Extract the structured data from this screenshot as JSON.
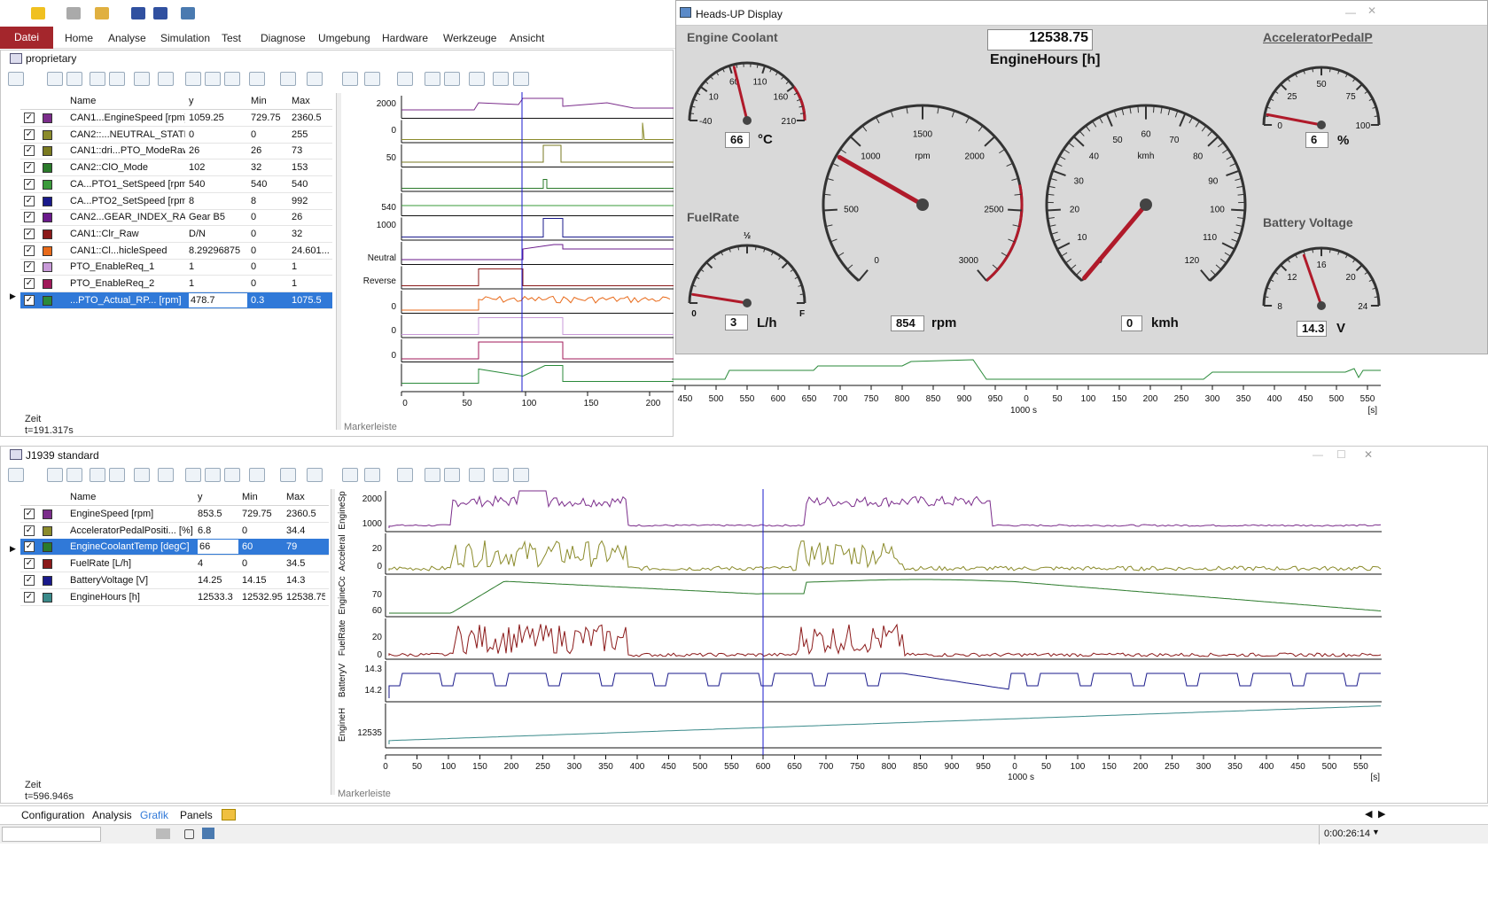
{
  "menu": {
    "file": "Datei",
    "items": [
      "Home",
      "Analyse",
      "Simulation",
      "Test",
      "Diagnose",
      "Umgebung",
      "Hardware",
      "Werkzeuge",
      "Ansicht"
    ]
  },
  "window1": {
    "title": "proprietary",
    "columns": [
      "Name",
      "y",
      "Min",
      "Max"
    ],
    "rows": [
      {
        "name": "CAN1...EngineSpeed [rpm]",
        "y": "1059.25",
        "min": "729.75",
        "max": "2360.5",
        "color": "#7b2d8b",
        "selected": false
      },
      {
        "name": "CAN2::...NEUTRAL_STATE",
        "y": "0",
        "min": "0",
        "max": "255",
        "color": "#8b8b2b",
        "selected": false
      },
      {
        "name": "CAN1::dri...PTO_ModeRaw",
        "y": "26",
        "min": "26",
        "max": "73",
        "color": "#7a7a20",
        "selected": false
      },
      {
        "name": "CAN2::ClO_Mode",
        "y": "102",
        "min": "32",
        "max": "153",
        "color": "#2a7a2a",
        "selected": false
      },
      {
        "name": "CA...PTO1_SetSpeed [rpm]",
        "y": "540",
        "min": "540",
        "max": "540",
        "color": "#3a9a3a",
        "selected": false
      },
      {
        "name": "CA...PTO2_SetSpeed [rpm]",
        "y": "8",
        "min": "8",
        "max": "992",
        "color": "#1a1a8b",
        "selected": false
      },
      {
        "name": "CAN2...GEAR_INDEX_RAW",
        "y": "Gear B5",
        "min": "0",
        "max": "26",
        "color": "#6a1a8b",
        "selected": false
      },
      {
        "name": "CAN1::Clr_Raw",
        "y": "D/N",
        "min": "0",
        "max": "32",
        "color": "#8b1a1a",
        "selected": false
      },
      {
        "name": "CAN1::Cl...hicleSpeed",
        "y": "8.29296875",
        "min": "0",
        "max": "24.601...",
        "color": "#e86a1a",
        "selected": false
      },
      {
        "name": "PTO_EnableReq_1",
        "y": "1",
        "min": "0",
        "max": "1",
        "color": "#c89ad8",
        "selected": false
      },
      {
        "name": "PTO_EnableReq_2",
        "y": "1",
        "min": "0",
        "max": "1",
        "color": "#a01a5a",
        "selected": false
      },
      {
        "name": "...PTO_Actual_RP... [rpm]",
        "y": "478.7",
        "min": "0.3",
        "max": "1075.5",
        "color": "#2a8a3a",
        "selected": true
      }
    ],
    "zeit_label": "Zeit",
    "zeit_value": "t=191.317s",
    "marker_label": "Markerleiste",
    "axis_unit": "1000 s",
    "axis_s": "[s]",
    "ticks": [
      "0",
      "50",
      "100",
      "150",
      "200",
      "250",
      "300",
      "350",
      "400",
      "450",
      "500",
      "550",
      "600",
      "650",
      "700",
      "750",
      "800",
      "850",
      "900",
      "950",
      "0",
      "50",
      "100",
      "150",
      "200",
      "250",
      "300",
      "350",
      "400",
      "450",
      "500",
      "550"
    ],
    "track_labels": [
      "2000",
      "0",
      "50",
      "540",
      "1000",
      "Neutral",
      "Reverse",
      "0",
      "0",
      "0"
    ]
  },
  "window2": {
    "title": "J1939 standard",
    "columns": [
      "Name",
      "y",
      "Min",
      "Max"
    ],
    "rows": [
      {
        "name": "EngineSpeed [rpm]",
        "y": "853.5",
        "min": "729.75",
        "max": "2360.5",
        "color": "#7b2d8b",
        "selected": false
      },
      {
        "name": "AcceleratorPedalPositi... [%]",
        "y": "6.8",
        "min": "0",
        "max": "34.4",
        "color": "#8b8b2b",
        "selected": false
      },
      {
        "name": "EngineCoolantTemp [degC]",
        "y": "66",
        "min": "60",
        "max": "79",
        "color": "#2a7a2a",
        "selected": true
      },
      {
        "name": "FuelRate [L/h]",
        "y": "4",
        "min": "0",
        "max": "34.5",
        "color": "#8b1a1a",
        "selected": false
      },
      {
        "name": "BatteryVoltage [V]",
        "y": "14.25",
        "min": "14.15",
        "max": "14.3",
        "color": "#1a1a8b",
        "selected": false
      },
      {
        "name": "EngineHours [h]",
        "y": "12533.3",
        "min": "12532.95",
        "max": "12538.75",
        "color": "#3a8a8a",
        "selected": false
      }
    ],
    "zeit_label": "Zeit",
    "zeit_value": "t=596.946s",
    "marker_label": "Markerleiste",
    "axis_unit": "1000 s",
    "axis_s": "[s]",
    "track_names": [
      "EngineSp",
      "Acceleral",
      "EngineCc",
      "FuelRate",
      "BatteryV",
      "EngineH"
    ],
    "track_labels": [
      "2000",
      "1000",
      "20",
      "0",
      "70",
      "60",
      "20",
      "0",
      "14.3",
      "14.2",
      "12535"
    ]
  },
  "hud": {
    "title": "Heads-UP Display",
    "engine_hours_value": "12538.75",
    "engine_hours_label": "EngineHours [h]",
    "coolant": {
      "label": "Engine Coolant",
      "value": "66",
      "unit": "°C",
      "ticks": [
        "-40",
        "10",
        "60",
        "110",
        "160",
        "210"
      ]
    },
    "accel": {
      "label": "AcceleratorPedalP",
      "value": "6",
      "unit": "%",
      "ticks": [
        "0",
        "25",
        "50",
        "75",
        "100"
      ]
    },
    "fuel": {
      "label": "FuelRate",
      "value": "3",
      "unit": "L/h",
      "empty": "0",
      "half": "½",
      "full": "F"
    },
    "battery": {
      "label": "Battery Voltage",
      "value": "14.3",
      "unit": "V",
      "ticks": [
        "8",
        "12",
        "16",
        "20",
        "24"
      ]
    },
    "rpm": {
      "value": "854",
      "unit": "rpm",
      "inner": "rpm",
      "ticks": [
        "0",
        "500",
        "1000",
        "1500",
        "2000",
        "2500",
        "3000"
      ]
    },
    "speed": {
      "value": "0",
      "unit": "kmh",
      "inner": "kmh",
      "ticks": [
        "0",
        "10",
        "20",
        "30",
        "40",
        "50",
        "60",
        "70",
        "80",
        "90",
        "100",
        "110",
        "120"
      ]
    }
  },
  "bottom_tabs": [
    "Configuration",
    "Analysis",
    "Grafik",
    "Panels"
  ],
  "status": {
    "time": "0:00:26:14"
  },
  "colors": {
    "accent": "#a4262c",
    "selection": "#3079d8",
    "cursor": "#1a1acc",
    "needle": "#b01a2a"
  }
}
